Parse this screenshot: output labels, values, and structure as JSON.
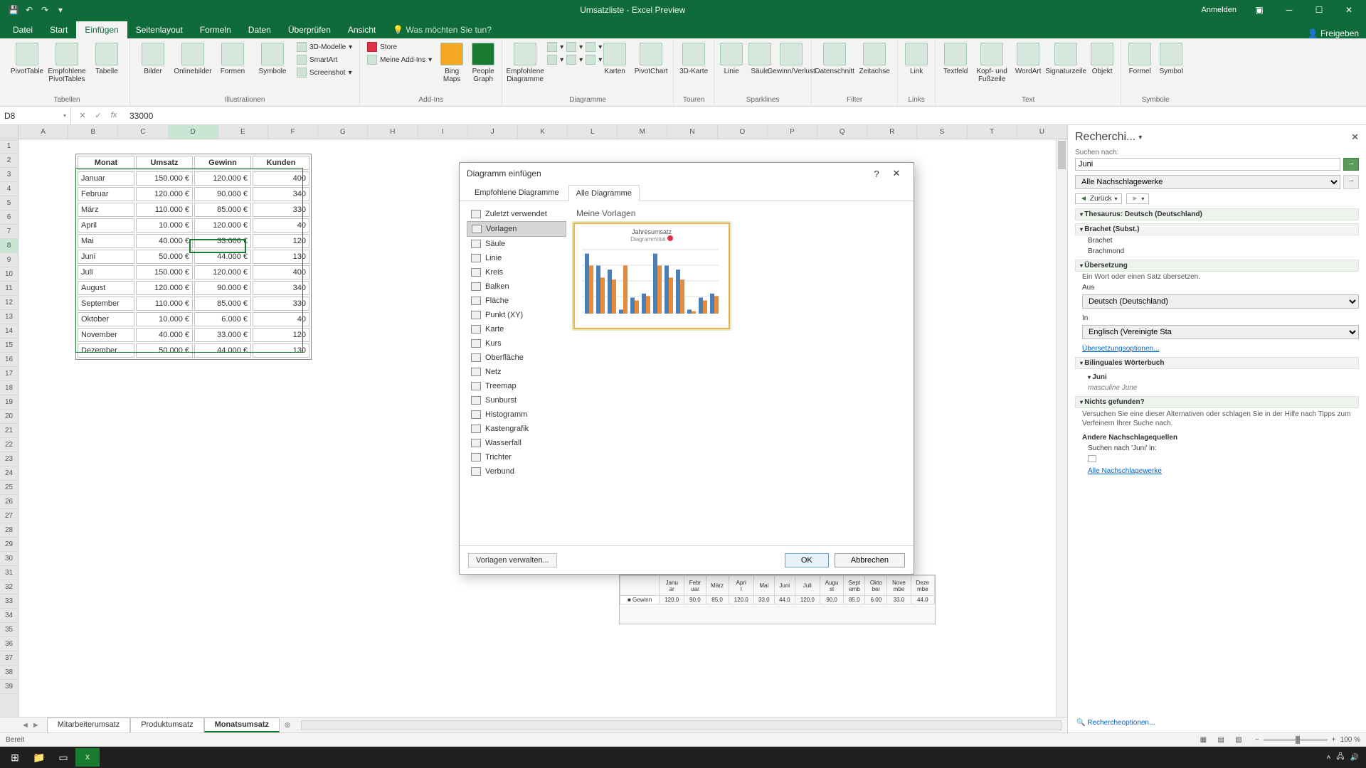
{
  "titlebar": {
    "title": "Umsatzliste - Excel Preview",
    "signin": "Anmelden"
  },
  "ribbon_tabs": [
    "Datei",
    "Start",
    "Einfügen",
    "Seitenlayout",
    "Formeln",
    "Daten",
    "Überprüfen",
    "Ansicht"
  ],
  "ribbon_active_tab": "Einfügen",
  "tell_me": "Was möchten Sie tun?",
  "share": "Freigeben",
  "ribbon_groups": {
    "tables": {
      "label": "Tabellen",
      "pivot": "PivotTable",
      "rec_pivot": "Empfohlene PivotTables",
      "table": "Tabelle"
    },
    "illus": {
      "label": "Illustrationen",
      "pics": "Bilder",
      "online": "Onlinebilder",
      "shapes": "Formen",
      "icons": "Symbole",
      "models": "3D-Modelle",
      "smartart": "SmartArt",
      "screenshot": "Screenshot"
    },
    "addins": {
      "label": "Add-Ins",
      "store": "Store",
      "myaddins": "Meine Add-Ins",
      "bing": "Bing Maps",
      "people": "People Graph"
    },
    "charts": {
      "label": "Diagramme",
      "rec": "Empfohlene Diagramme",
      "maps": "Karten",
      "pivotchart": "PivotChart"
    },
    "tours": {
      "label": "Touren",
      "map3d": "3D-Karte"
    },
    "spark": {
      "label": "Sparklines",
      "line": "Linie",
      "col": "Säule",
      "winloss": "Gewinn/Verlust"
    },
    "filter": {
      "label": "Filter",
      "slicer": "Datenschnitt",
      "timeline": "Zeitachse"
    },
    "links": {
      "label": "Links",
      "link": "Link"
    },
    "text": {
      "label": "Text",
      "textbox": "Textfeld",
      "headerfooter": "Kopf- und Fußzeile",
      "wordart": "WordArt",
      "sigline": "Signaturzeile",
      "object": "Objekt"
    },
    "symbols": {
      "label": "Symbole",
      "eq": "Formel",
      "sym": "Symbol"
    }
  },
  "namebox": "D8",
  "formula": "33000",
  "columns": [
    "A",
    "B",
    "C",
    "D",
    "E",
    "F",
    "G",
    "H",
    "I",
    "J",
    "K",
    "L",
    "M",
    "N",
    "O",
    "P",
    "Q",
    "R",
    "S",
    "T",
    "U"
  ],
  "row_count": 39,
  "table": {
    "headers": [
      "Monat",
      "Umsatz",
      "Gewinn",
      "Kunden"
    ],
    "rows": [
      [
        "Januar",
        "150.000 €",
        "120.000 €",
        "400"
      ],
      [
        "Februar",
        "120.000 €",
        "90.000 €",
        "340"
      ],
      [
        "März",
        "110.000 €",
        "85.000 €",
        "330"
      ],
      [
        "April",
        "10.000 €",
        "120.000 €",
        "40"
      ],
      [
        "Mai",
        "40.000 €",
        "33.000 €",
        "120"
      ],
      [
        "Juni",
        "50.000 €",
        "44.000 €",
        "130"
      ],
      [
        "Juli",
        "150.000 €",
        "120.000 €",
        "400"
      ],
      [
        "August",
        "120.000 €",
        "90.000 €",
        "340"
      ],
      [
        "September",
        "110.000 €",
        "85.000 €",
        "330"
      ],
      [
        "Oktober",
        "10.000 €",
        "6.000 €",
        "40"
      ],
      [
        "November",
        "40.000 €",
        "33.000 €",
        "120"
      ],
      [
        "Dezember",
        "50.000 €",
        "44.000 €",
        "130"
      ]
    ]
  },
  "dialog": {
    "title": "Diagramm einfügen",
    "tab_recommended": "Empfohlene Diagramme",
    "tab_all": "Alle Diagramme",
    "categories": [
      "Zuletzt verwendet",
      "Vorlagen",
      "Säule",
      "Linie",
      "Kreis",
      "Balken",
      "Fläche",
      "Punkt (XY)",
      "Karte",
      "Kurs",
      "Oberfläche",
      "Netz",
      "Treemap",
      "Sunburst",
      "Histogramm",
      "Kastengrafik",
      "Wasserfall",
      "Trichter",
      "Verbund"
    ],
    "selected_category": "Vorlagen",
    "templates_title": "Meine Vorlagen",
    "template_caption": "Jahresumsatz",
    "template_subtitle": "Diagrammtitel",
    "manage": "Vorlagen verwalten...",
    "ok": "OK",
    "cancel": "Abbrechen"
  },
  "chart_peek": {
    "months_short": [
      "Januar",
      "Februar",
      "März",
      "April",
      "Mai",
      "Juni",
      "Juli",
      "August",
      "September",
      "Oktober",
      "November",
      "Dezember"
    ],
    "series_label": "Gewinn",
    "values": [
      "120.0",
      "90.0",
      "85.0",
      "120.0",
      "33.0",
      "44.0",
      "120.0",
      "90.0",
      "85.0",
      "6.00",
      "33.0",
      "44.0"
    ]
  },
  "sheets": {
    "tabs": [
      "Mitarbeiterumsatz",
      "Produktumsatz",
      "Monatsumsatz"
    ],
    "active": "Monatsumsatz"
  },
  "status": {
    "ready": "Bereit",
    "zoom": "100 %"
  },
  "pane": {
    "title": "Recherchi...",
    "search_label": "Suchen nach:",
    "search_value": "Juni",
    "all_books": "Alle Nachschlagewerke",
    "back": "Zurück",
    "thesaurus": "Thesaurus: Deutsch (Deutschland)",
    "brachet": "Brachet (Subst.)",
    "brachet_items": [
      "Brachet",
      "Brachmond"
    ],
    "translation": "Übersetzung",
    "trans_hint": "Ein Wort oder einen Satz übersetzen.",
    "from_label": "Aus",
    "from_lang": "Deutsch (Deutschland)",
    "to_label": "In",
    "to_lang": "Englisch (Vereinigte Sta",
    "trans_options": "Übersetzungsoptionen...",
    "bilingual": "Bilinguales Wörterbuch",
    "juni": "Juni",
    "juni_gloss": "masculine June",
    "not_found": "Nichts gefunden?",
    "not_found_text": "Versuchen Sie eine dieser Alternativen oder schlagen Sie in der Hilfe nach Tipps zum Verfeinern Ihrer Suche nach.",
    "other_sources": "Andere Nachschlagequellen",
    "search_in": "Suchen nach 'Juni' in:",
    "all_link": "Alle Nachschlagewerke",
    "options": "Rechercheoptionen..."
  },
  "chart_data": {
    "type": "bar",
    "title": "Jahresumsatz",
    "subtitle": "Diagrammtitel",
    "categories": [
      "Januar",
      "Februar",
      "März",
      "April",
      "Mai",
      "Juni",
      "Juli",
      "August",
      "September",
      "Oktober",
      "November",
      "Dezember"
    ],
    "series": [
      {
        "name": "Umsatz",
        "values": [
          150000,
          120000,
          110000,
          10000,
          40000,
          50000,
          150000,
          120000,
          110000,
          10000,
          40000,
          50000
        ]
      },
      {
        "name": "Gewinn",
        "values": [
          120000,
          90000,
          85000,
          120000,
          33000,
          44000,
          120000,
          90000,
          85000,
          6000,
          33000,
          44000
        ]
      }
    ],
    "ylim": [
      0,
      160000
    ]
  }
}
